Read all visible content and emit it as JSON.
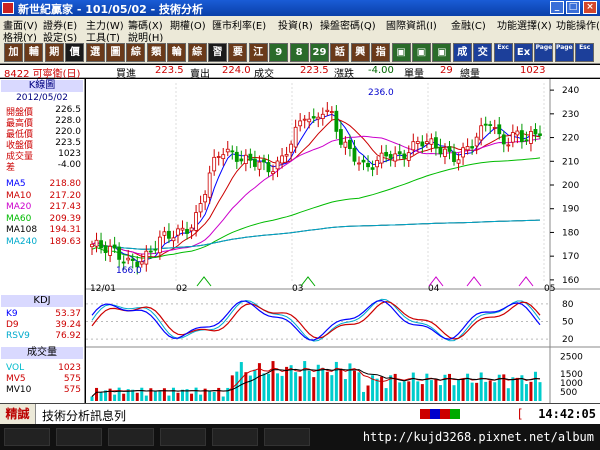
{
  "window": {
    "title": "新世紀贏家 - 101/05/02 - 技術分析",
    "buttons": [
      "_",
      "□",
      "×"
    ]
  },
  "menu": {
    "row1": [
      "畫面(V)",
      "證券(E)",
      "主力(W)",
      "籌碼(X)",
      "期權(O)",
      "匯市利率(E)",
      "投資(R)",
      "操盤密碼(Q)",
      "國際資訊(I)",
      "金融(C)",
      "功能選擇(X)",
      "功能操作(F)"
    ],
    "row2": [
      "格視(Y)",
      "設定(S)",
      "工具(T)",
      "說明(H)"
    ]
  },
  "toolbar": {
    "buttons": [
      "加",
      "輔",
      "期",
      "價",
      "選",
      "圖",
      "綜",
      "類",
      "輪",
      "綜",
      "習",
      "要",
      "江",
      "9",
      "8",
      "29",
      "話",
      "興",
      "指",
      "▣",
      "▣",
      "▣",
      "成",
      "交",
      "Exc",
      "Ex",
      "Page",
      "Page",
      "Esc"
    ]
  },
  "quote": {
    "code": "8422 可寧衛(日)",
    "buy_label": "買進",
    "buy": "223.5",
    "sell_label": "賣出",
    "sell": "224.0",
    "last_label": "成交",
    "last": "223.5",
    "chg_label": "漲跌",
    "chg": "-4.00",
    "vol_label": "單量",
    "vol": "29",
    "total_label": "總量",
    "total": "1023"
  },
  "panel": {
    "title": "K線圖",
    "date": "2012/05/02",
    "ohlc": [
      {
        "label": "開盤價",
        "value": "226.5"
      },
      {
        "label": "最高價",
        "value": "228.0"
      },
      {
        "label": "最低價",
        "value": "220.0"
      },
      {
        "label": "收盤價",
        "value": "223.5"
      },
      {
        "label": "成交量",
        "value": "1023"
      },
      {
        "label": "差",
        "value": "-4.00"
      }
    ],
    "ma": [
      {
        "label": "MA5",
        "value": "218.80",
        "color": "#0000ff"
      },
      {
        "label": "MA10",
        "value": "217.20",
        "color": "#cc0000"
      },
      {
        "label": "MA20",
        "value": "217.43",
        "color": "#cc00cc"
      },
      {
        "label": "MA60",
        "value": "209.39",
        "color": "#00bb00"
      },
      {
        "label": "MA108",
        "value": "194.31",
        "color": "#000000"
      },
      {
        "label": "MA240",
        "value": "189.63",
        "color": "#00aacc"
      }
    ],
    "kdj_title": "KDJ",
    "kdj": [
      {
        "label": "K9",
        "value": "53.37",
        "color": "#0000ff"
      },
      {
        "label": "D9",
        "value": "39.24",
        "color": "#cc0000"
      },
      {
        "label": "RSV9",
        "value": "76.92",
        "color": "#00aacc"
      }
    ],
    "vol_title": "成交量",
    "vol": [
      {
        "label": "VOL",
        "value": "1023",
        "color": "#00bbcc"
      },
      {
        "label": "MV5",
        "value": "575",
        "color": "#cc0000"
      },
      {
        "label": "MV10",
        "value": "575",
        "color": "#000000"
      }
    ]
  },
  "chart_data": {
    "type": "candlestick",
    "price_axis_ticks": [
      160,
      170,
      180,
      190,
      200,
      210,
      220,
      230,
      240
    ],
    "ylim": [
      157,
      243
    ],
    "x_labels": [
      "12/01",
      "02",
      "03",
      "04",
      "05"
    ],
    "annotations": [
      {
        "label": "236.0"
      },
      {
        "label": "166.0"
      }
    ],
    "kdj_axis_ticks": [
      20,
      50,
      80
    ],
    "vol_axis_ticks": [
      500,
      1000,
      1500,
      2500
    ]
  },
  "status": {
    "brand": "精誠",
    "message": "技術分析訊息列",
    "bracket": "[",
    "clock": "14:42:05"
  },
  "taskbar": {
    "url": "http://kujd3268.pixnet.net/album"
  }
}
